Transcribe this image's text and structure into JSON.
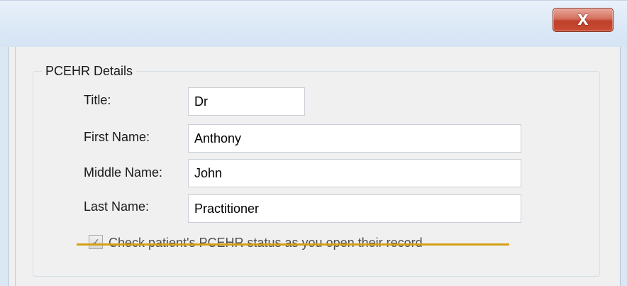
{
  "window": {
    "close_glyph": "X"
  },
  "group": {
    "legend": "PCEHR Details"
  },
  "form": {
    "title": {
      "label": "Title:",
      "value": "Dr"
    },
    "first_name": {
      "label": "First Name:",
      "value": "Anthony"
    },
    "middle_name": {
      "label": "Middle Name:",
      "value": "John"
    },
    "last_name": {
      "label": "Last Name:",
      "value": "Practitioner"
    }
  },
  "check_status": {
    "label": "Check patient's PCEHR status as you open their record",
    "checked": true,
    "check_glyph": "✓"
  },
  "colors": {
    "strike_annotation": "#d4a017",
    "close_button": "#c84b33"
  }
}
